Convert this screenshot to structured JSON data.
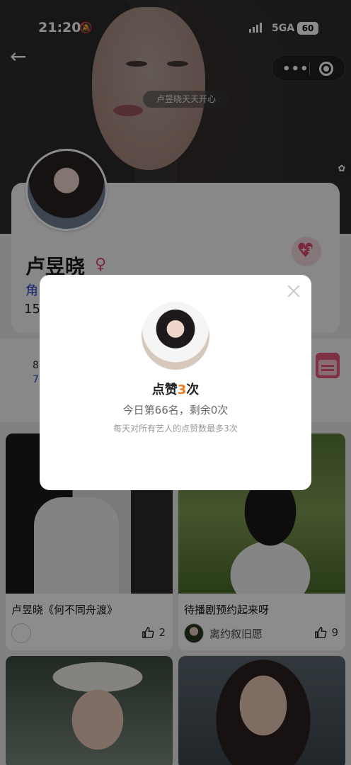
{
  "status_bar": {
    "time": "21:20",
    "network": "5GA",
    "battery": "60"
  },
  "header": {
    "tag_text": "卢昱晓天天开心",
    "capsule_dots": "•••"
  },
  "profile": {
    "name": "卢昱晓",
    "role_partial": "角",
    "count_partial": "15",
    "like_plus": "+3"
  },
  "stats": {
    "n1_partial": "8",
    "n2_partial": "7"
  },
  "posts": [
    {
      "title": "卢昱晓《何不同舟渡》",
      "author": "",
      "likes": "2"
    },
    {
      "title": "待播剧预约起来呀",
      "author": "离约叙旧愿",
      "likes": "9"
    },
    {
      "title": "",
      "author": "",
      "likes": ""
    },
    {
      "title": "",
      "author": "",
      "likes": ""
    }
  ],
  "modal": {
    "headline_prefix": "点赞",
    "headline_count": "3",
    "headline_suffix": "次",
    "rank_line": "今日第66名，剩余0次",
    "rule_line": "每天对所有艺人的点赞数最多3次"
  },
  "colors": {
    "accent_pink": "#e0476e",
    "link_blue": "#2443cf",
    "count_orange": "#f07a19"
  }
}
